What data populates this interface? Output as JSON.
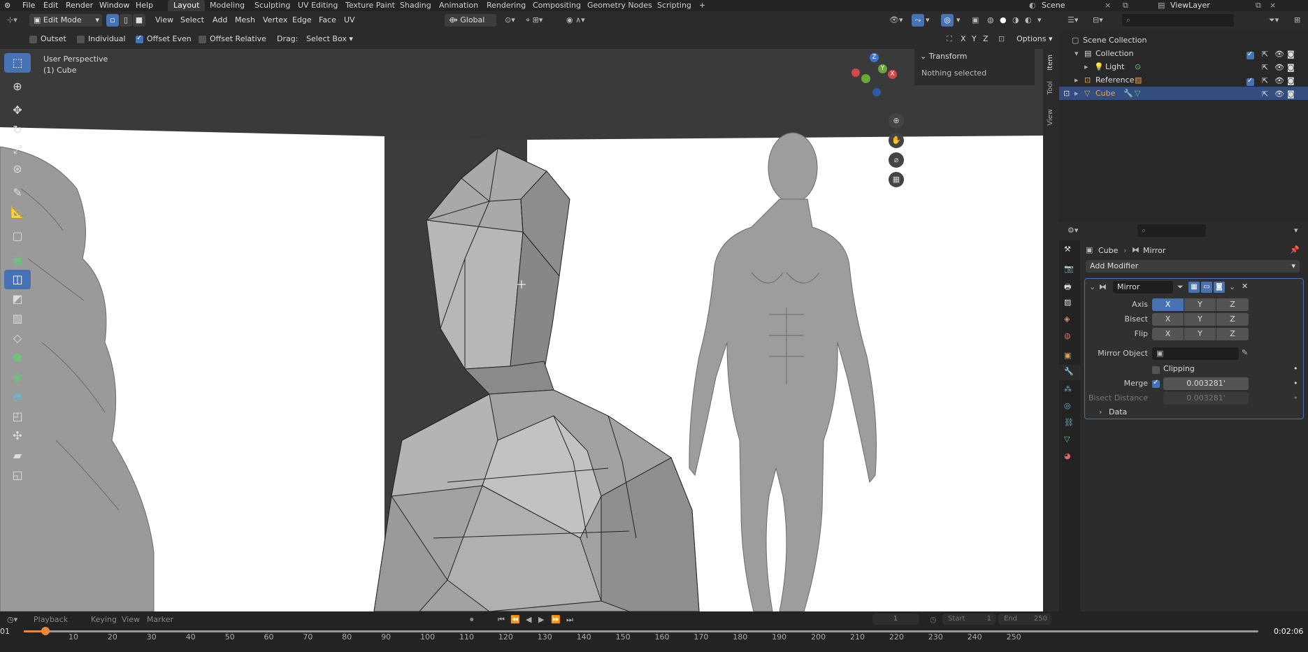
{
  "topbar": {
    "menus": [
      "File",
      "Edit",
      "Render",
      "Window",
      "Help"
    ],
    "workspaces": [
      "Layout",
      "Modeling",
      "Sculpting",
      "UV Editing",
      "Texture Paint",
      "Shading",
      "Animation",
      "Rendering",
      "Compositing",
      "Geometry Nodes",
      "Scripting"
    ],
    "active_workspace": "Layout",
    "add_tab": "+",
    "scene_label": "Scene",
    "view_layer_label": "ViewLayer"
  },
  "header": {
    "mode": "Edit Mode",
    "menus": [
      "View",
      "Select",
      "Add",
      "Mesh",
      "Vertex",
      "Edge",
      "Face",
      "UV"
    ],
    "transform_orientation": "Global"
  },
  "tool_options": {
    "outset_label": "Outset",
    "outset_checked": false,
    "individual_label": "Individual",
    "individual_checked": false,
    "offset_even_label": "Offset Even",
    "offset_even_checked": true,
    "offset_relative_label": "Offset Relative",
    "offset_relative_checked": false,
    "drag_label": "Drag:",
    "drag_value": "Select Box",
    "axis_x": "X",
    "axis_y": "Y",
    "axis_z": "Z",
    "options_label": "Options"
  },
  "viewport": {
    "view_name": "User Perspective",
    "object_name": "(1) Cube",
    "gizmo": {
      "x": "X",
      "y": "Y",
      "z": "Z"
    }
  },
  "sidebar": {
    "tabs": [
      "Item",
      "Tool",
      "View"
    ],
    "transform_title": "Transform",
    "transform_status": "Nothing selected"
  },
  "outliner": {
    "root": "Scene Collection",
    "items": [
      {
        "label": "Collection",
        "icon": "collection-icon"
      },
      {
        "label": "Light",
        "icon": "light-icon"
      },
      {
        "label": "Reference",
        "icon": "image-icon"
      },
      {
        "label": "Cube",
        "icon": "mesh-icon",
        "selected": true
      }
    ]
  },
  "properties": {
    "breadcrumb_object": "Cube",
    "breadcrumb_modifier": "Mirror",
    "add_modifier": "Add Modifier",
    "modifier_name": "Mirror",
    "axis_label": "Axis",
    "bisect_label": "Bisect",
    "flip_label": "Flip",
    "x": "X",
    "y": "Y",
    "z": "Z",
    "mirror_object_label": "Mirror Object",
    "clipping_label": "Clipping",
    "clipping_checked": false,
    "merge_label": "Merge",
    "merge_checked": true,
    "merge_value": "0.003281'",
    "bisect_distance_label": "Bisect Distance",
    "bisect_distance_value": "0.003281'",
    "data_label": "Data"
  },
  "timeline": {
    "menus": [
      "Playback",
      "Keying",
      "View",
      "Marker"
    ],
    "current_frame": "1",
    "start_label": "Start",
    "start_value": "1",
    "end_label": "End",
    "end_value": "250",
    "ticks": [
      "10",
      "20",
      "30",
      "40",
      "50",
      "60",
      "70",
      "80",
      "90",
      "100",
      "110",
      "120",
      "130",
      "140",
      "150",
      "160",
      "170",
      "180",
      "190",
      "200",
      "210",
      "220",
      "230",
      "240",
      "250"
    ],
    "playhead_frame": "01",
    "elapsed": "0:02:06"
  },
  "colors": {
    "accent": "#4772b3",
    "selected_row": "#334d80",
    "panel_bg": "#2b2b2b",
    "viewport_bg": "#3a3a3a"
  }
}
